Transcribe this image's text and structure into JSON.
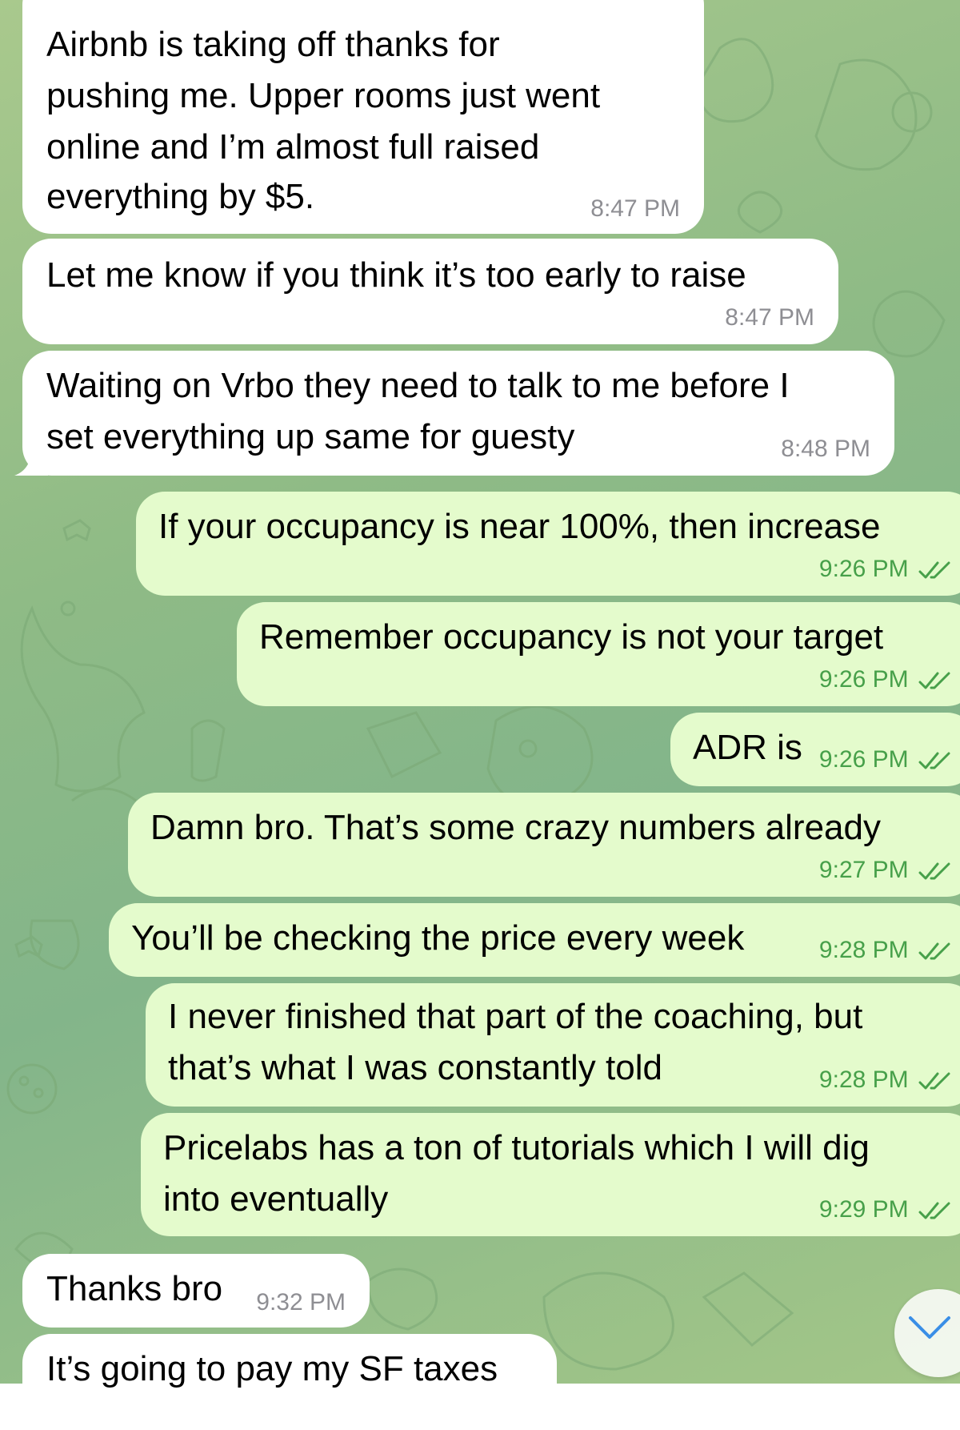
{
  "chat": {
    "messages": [
      {
        "direction": "incoming",
        "lines": [
          "Airbnb is taking off thanks for",
          "pushing me.  Upper rooms just went",
          "online and I’m almost full raised",
          "everything by $5."
        ],
        "time": "8:47 PM"
      },
      {
        "direction": "incoming",
        "lines": [
          "Let me know if you think it’s too early to raise"
        ],
        "time": "8:47 PM"
      },
      {
        "direction": "incoming",
        "lines": [
          "Waiting on Vrbo they need to talk to me before I",
          "set everything up same for guesty"
        ],
        "time": "8:48 PM"
      },
      {
        "direction": "outgoing",
        "lines": [
          "If your occupancy is near 100%, then increase"
        ],
        "time": "9:26 PM",
        "status": "read"
      },
      {
        "direction": "outgoing",
        "lines": [
          "Remember occupancy is not your target"
        ],
        "time": "9:26 PM",
        "status": "read"
      },
      {
        "direction": "outgoing",
        "lines": [
          "ADR is"
        ],
        "time": "9:26 PM",
        "status": "read"
      },
      {
        "direction": "outgoing",
        "lines": [
          "Damn bro. That’s some crazy numbers already"
        ],
        "time": "9:27 PM",
        "status": "read"
      },
      {
        "direction": "outgoing",
        "lines": [
          "You’ll be checking the price every week"
        ],
        "time": "9:28 PM",
        "status": "read"
      },
      {
        "direction": "outgoing",
        "lines": [
          "I never finished that part of the coaching, but",
          "that’s what I was constantly told"
        ],
        "time": "9:28 PM",
        "status": "read"
      },
      {
        "direction": "outgoing",
        "lines": [
          "Pricelabs has a ton of tutorials which I will dig",
          "into eventually"
        ],
        "time": "9:29 PM",
        "status": "read"
      },
      {
        "direction": "incoming",
        "lines": [
          "Thanks bro"
        ],
        "time": "9:32 PM"
      },
      {
        "direction": "incoming",
        "lines": [
          "It’s going to pay my SF taxes"
        ],
        "time": ""
      }
    ]
  },
  "icons": {
    "read_receipt": "double-check-icon",
    "scroll_down": "chevron-down-icon"
  },
  "colors": {
    "incoming_bubble": "#ffffff",
    "outgoing_bubble": "#e4fbcc",
    "outgoing_meta": "#47a04a",
    "incoming_meta": "#8e8e93",
    "wallpaper": "#8fbb86"
  }
}
